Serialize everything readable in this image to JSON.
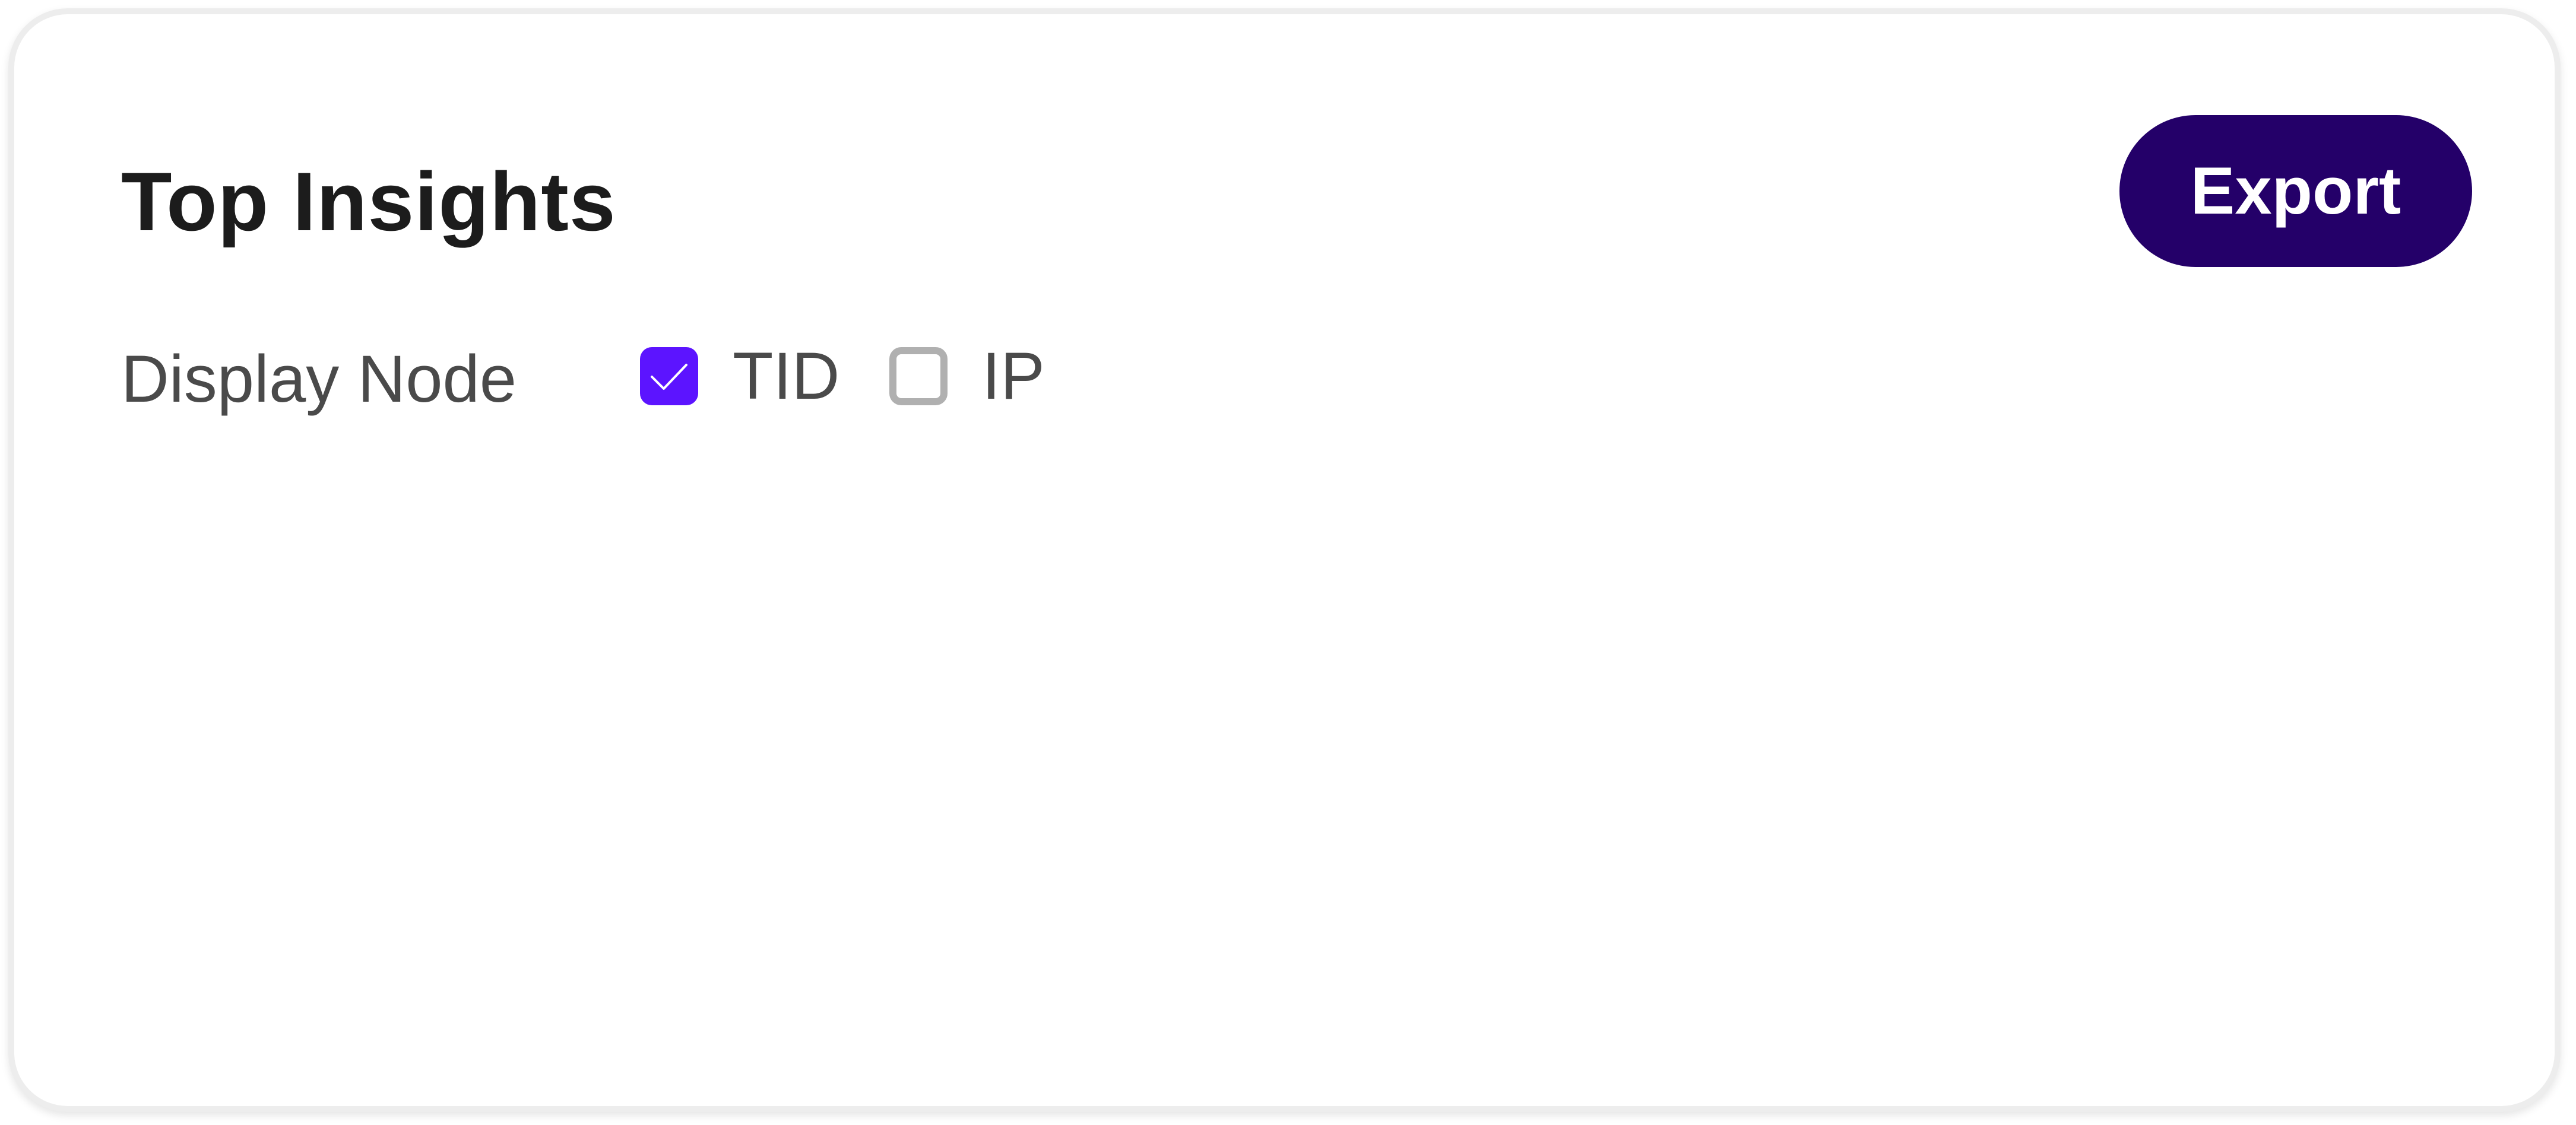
{
  "panel": {
    "title": "Top Insights",
    "export_label": "Export",
    "accent_color": "#240069"
  },
  "display_node": {
    "label": "Display Node",
    "options": [
      {
        "label": "TID",
        "checked": true,
        "color": "#5c14ff"
      },
      {
        "label": "IP",
        "checked": false,
        "color": "#b0b0b0"
      }
    ]
  },
  "icons": {
    "checked": "checkmark-icon"
  }
}
